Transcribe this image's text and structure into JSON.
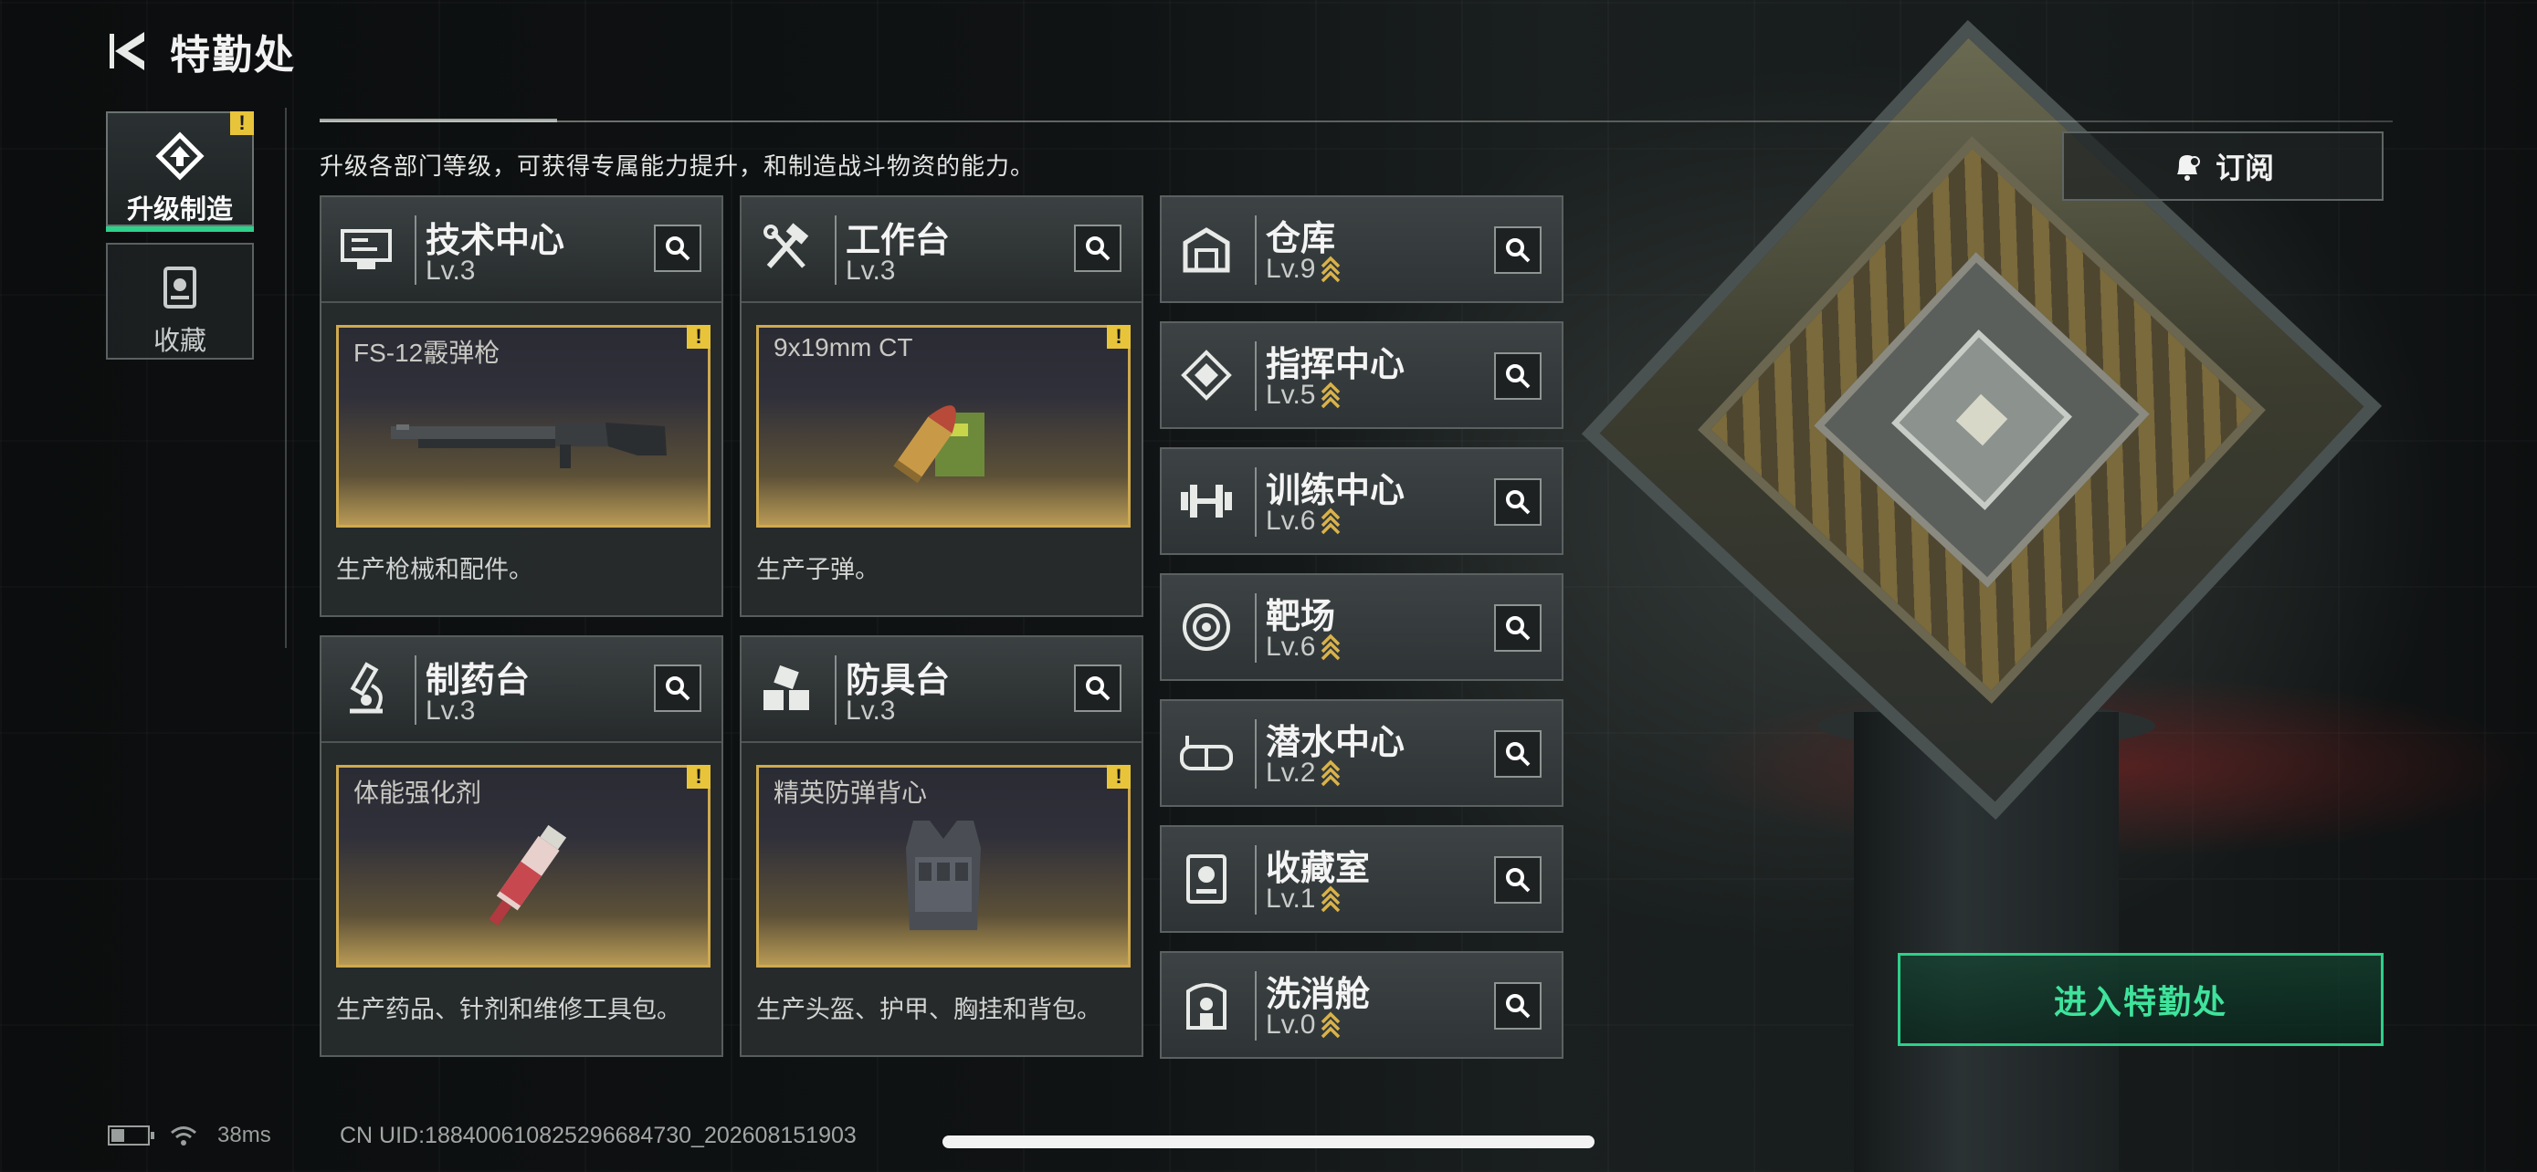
{
  "header": {
    "title": "特勤处"
  },
  "side_tabs": [
    {
      "label": "升级制造",
      "icon": "upgrade-build-icon",
      "active": true,
      "badge": "!"
    },
    {
      "label": "收藏",
      "icon": "collection-icon",
      "active": false
    }
  ],
  "intro": "升级各部门等级，可获得专属能力提升，和制造战斗物资的能力。",
  "departments": [
    {
      "name": "技术中心",
      "level": "Lv.3",
      "icon": "tech-center-icon",
      "product": "FS-12霰弹枪",
      "product_badge": "!",
      "description": "生产枪械和配件。"
    },
    {
      "name": "工作台",
      "level": "Lv.3",
      "icon": "workbench-icon",
      "product": "9x19mm CT",
      "product_badge": "!",
      "description": "生产子弹。"
    },
    {
      "name": "制药台",
      "level": "Lv.3",
      "icon": "pharmacy-icon",
      "product": "体能强化剂",
      "product_badge": "!",
      "description": "生产药品、针剂和维修工具包。"
    },
    {
      "name": "防具台",
      "level": "Lv.3",
      "icon": "armor-bench-icon",
      "product": "精英防弹背心",
      "product_badge": "!",
      "description": "生产头盔、护甲、胸挂和背包。"
    }
  ],
  "facilities": [
    {
      "name": "仓库",
      "level": "Lv.9",
      "icon": "warehouse-icon"
    },
    {
      "name": "指挥中心",
      "level": "Lv.5",
      "icon": "command-center-icon"
    },
    {
      "name": "训练中心",
      "level": "Lv.6",
      "icon": "training-center-icon"
    },
    {
      "name": "靶场",
      "level": "Lv.6",
      "icon": "shooting-range-icon"
    },
    {
      "name": "潜水中心",
      "level": "Lv.2",
      "icon": "diving-center-icon"
    },
    {
      "name": "收藏室",
      "level": "Lv.1",
      "icon": "collection-room-icon"
    },
    {
      "name": "洗消舱",
      "level": "Lv.0",
      "icon": "decon-chamber-icon"
    }
  ],
  "subscribe": {
    "label": "订阅"
  },
  "enter_button": {
    "label": "进入特勤处"
  },
  "status_bar": {
    "ping": "38ms",
    "uid": "CN UID:18840061082529668473​0_202608151903"
  },
  "colors": {
    "accent_green": "#2fcf8a",
    "gold": "#cfa94e",
    "warn_yellow": "#e8c43a"
  }
}
